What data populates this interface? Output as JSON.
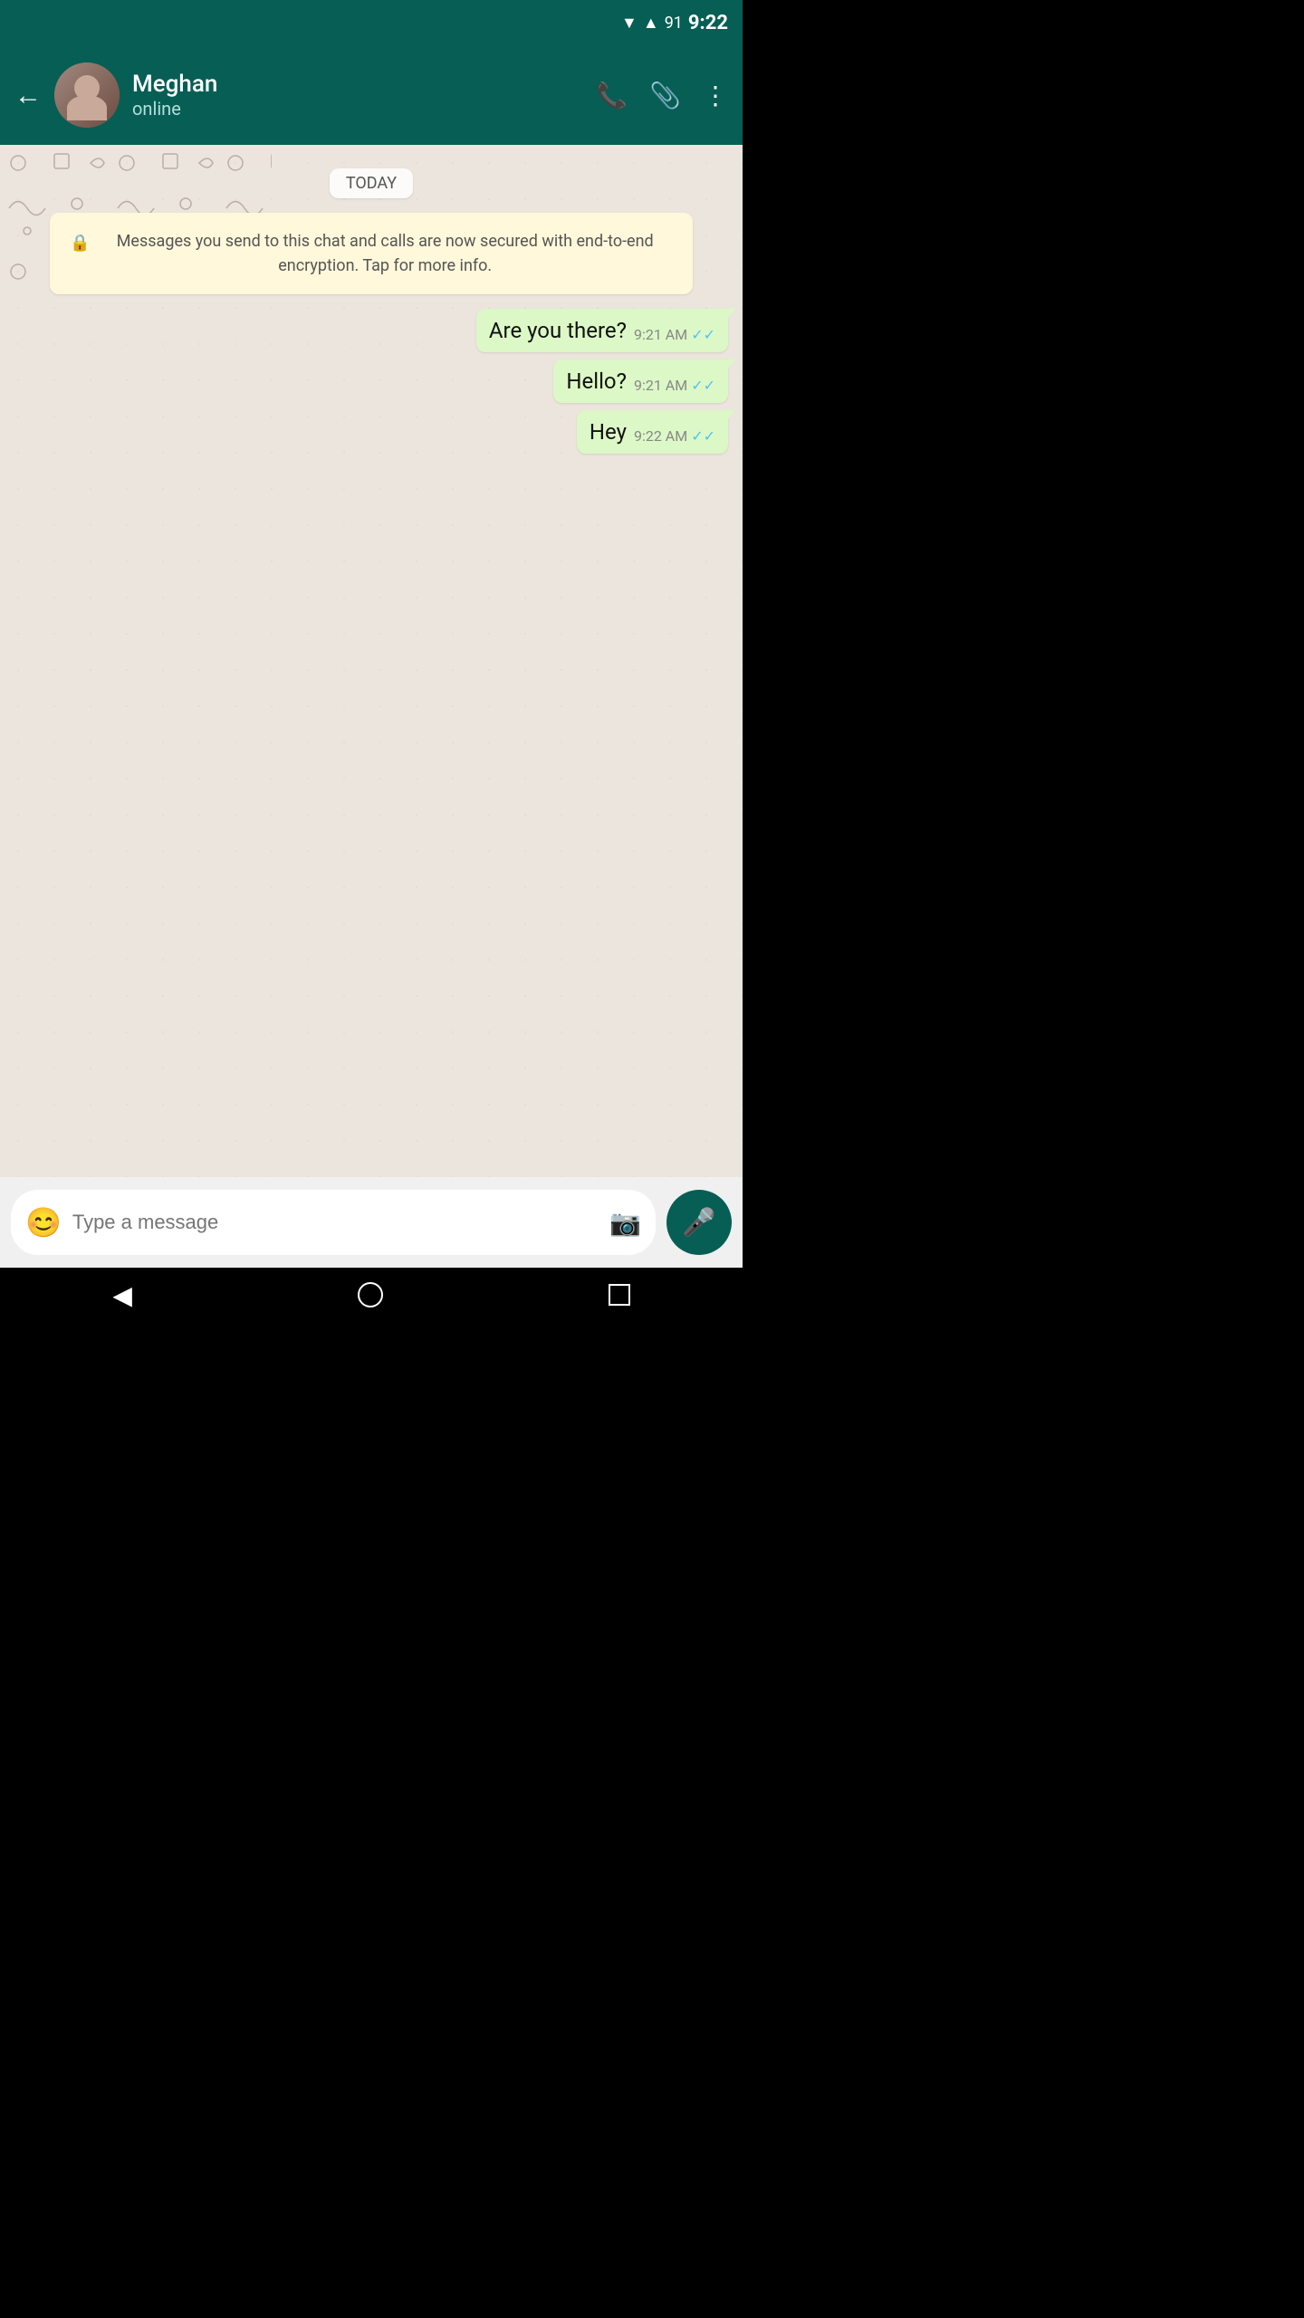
{
  "statusBar": {
    "time": "9:22",
    "battery": "91"
  },
  "header": {
    "backLabel": "←",
    "contactName": "Meghan",
    "contactStatus": "online",
    "callIcon": "📞",
    "attachIcon": "📎",
    "moreIcon": "⋮"
  },
  "chat": {
    "dateBadge": "TODAY",
    "encryptionNotice": "Messages you send to this chat and calls are now secured with end-to-end encryption. Tap for more info.",
    "lockIcon": "🔒",
    "messages": [
      {
        "text": "Are you there?",
        "time": "9:21 AM",
        "status": "✓✓"
      },
      {
        "text": "Hello?",
        "time": "9:21 AM",
        "status": "✓✓"
      },
      {
        "text": "Hey",
        "time": "9:22 AM",
        "status": "✓✓"
      }
    ]
  },
  "inputBar": {
    "placeholder": "Type a message",
    "emojiIcon": "😊",
    "cameraIcon": "📷",
    "micIcon": "🎤"
  },
  "navBar": {
    "backIcon": "◀",
    "homeIcon": "○",
    "recentIcon": "□"
  }
}
